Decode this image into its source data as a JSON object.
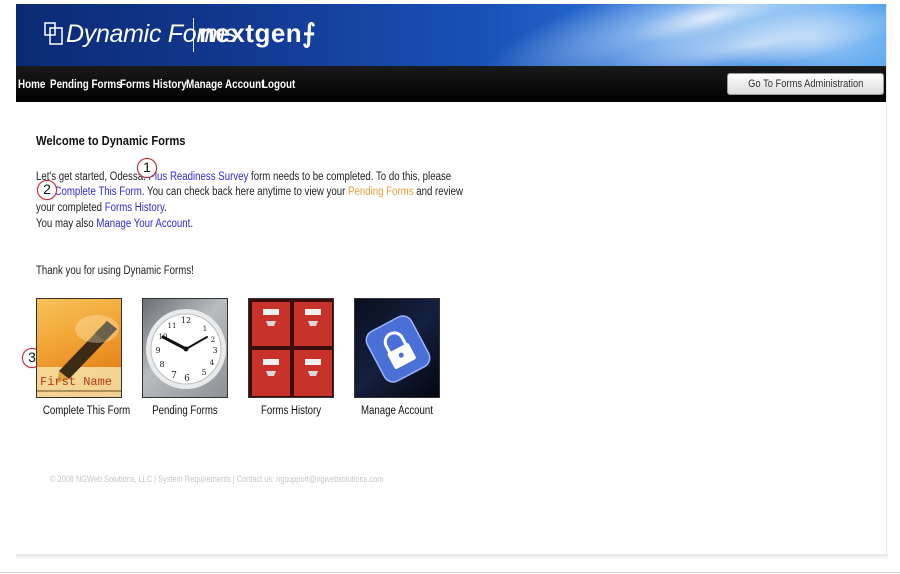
{
  "header": {
    "logo_text": "Dynamic Forms",
    "brand": "nextgen"
  },
  "nav": {
    "items": [
      {
        "label": "Home"
      },
      {
        "label": "Pending Forms"
      },
      {
        "label": "Forms History"
      },
      {
        "label": "Manage Account"
      },
      {
        "label": "Logout"
      }
    ],
    "admin_button": "Go To Forms Administration"
  },
  "content": {
    "title": "Welcome to Dynamic Forms",
    "line1_pre": "Let's get started, Odessa. ",
    "line1_link": "Plus Readiness Survey",
    "line1_post": " form needs to be completed. To do this, please",
    "line2_link1": "Complete This Form",
    "line2_mid": ". You can check back here anytime to view your ",
    "line2_link2": "Pending Forms",
    "line2_post": " and review",
    "line3_pre": "your completed ",
    "line3_link": "Forms History",
    "line3_post": ".",
    "line4_pre": "You may also ",
    "line4_link": "Manage Your Account",
    "line4_post": ".",
    "thanks": "Thank you for using Dynamic Forms!"
  },
  "callouts": [
    "1",
    "2",
    "3"
  ],
  "tiles": [
    {
      "label": "Complete This Form",
      "icon": "pen-form-icon",
      "image_text": "First Name"
    },
    {
      "label": "Pending Forms",
      "icon": "clock-icon"
    },
    {
      "label": "Forms History",
      "icon": "file-cabinet-icon"
    },
    {
      "label": "Manage Account",
      "icon": "padlock-icon"
    }
  ],
  "footer": "© 2008 NGWeb Solutions, LLC | System Requirements | Contact us: ngsupport@ngwebsolutions.com",
  "colors": {
    "link": "#2b2bd6",
    "link_orange": "#e8a03a",
    "nav_bg": "#000000",
    "banner_blue": "#123a93",
    "callout_border": "#c0262b"
  }
}
